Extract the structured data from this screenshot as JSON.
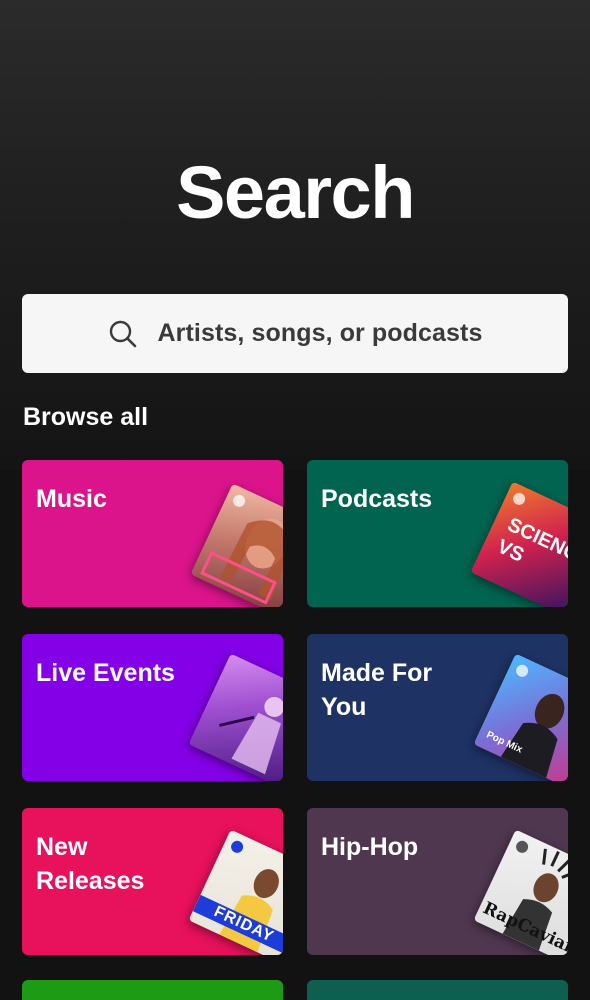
{
  "header": {
    "title": "Search"
  },
  "search": {
    "placeholder": "Artists, songs, or podcasts",
    "icon": "search-icon"
  },
  "browse": {
    "title": "Browse all",
    "tiles": [
      {
        "label": "Music",
        "color": "#dc148c",
        "art_text": ""
      },
      {
        "label": "Podcasts",
        "color": "#006450",
        "art_text": "SCIENCE VS"
      },
      {
        "label": "Live Events",
        "color": "#8400e7",
        "art_text": ""
      },
      {
        "label": "Made For You",
        "color": "#1e3264",
        "art_text": "Pop Mix"
      },
      {
        "label": "New Releases",
        "color": "#e8115b",
        "art_text": "FRIDAY"
      },
      {
        "label": "Hip-Hop",
        "color": "#503750",
        "art_text": "RapCaviar"
      }
    ],
    "partial_tiles": [
      {
        "color": "#1e9b14"
      },
      {
        "color": "#0d5f50"
      }
    ]
  }
}
